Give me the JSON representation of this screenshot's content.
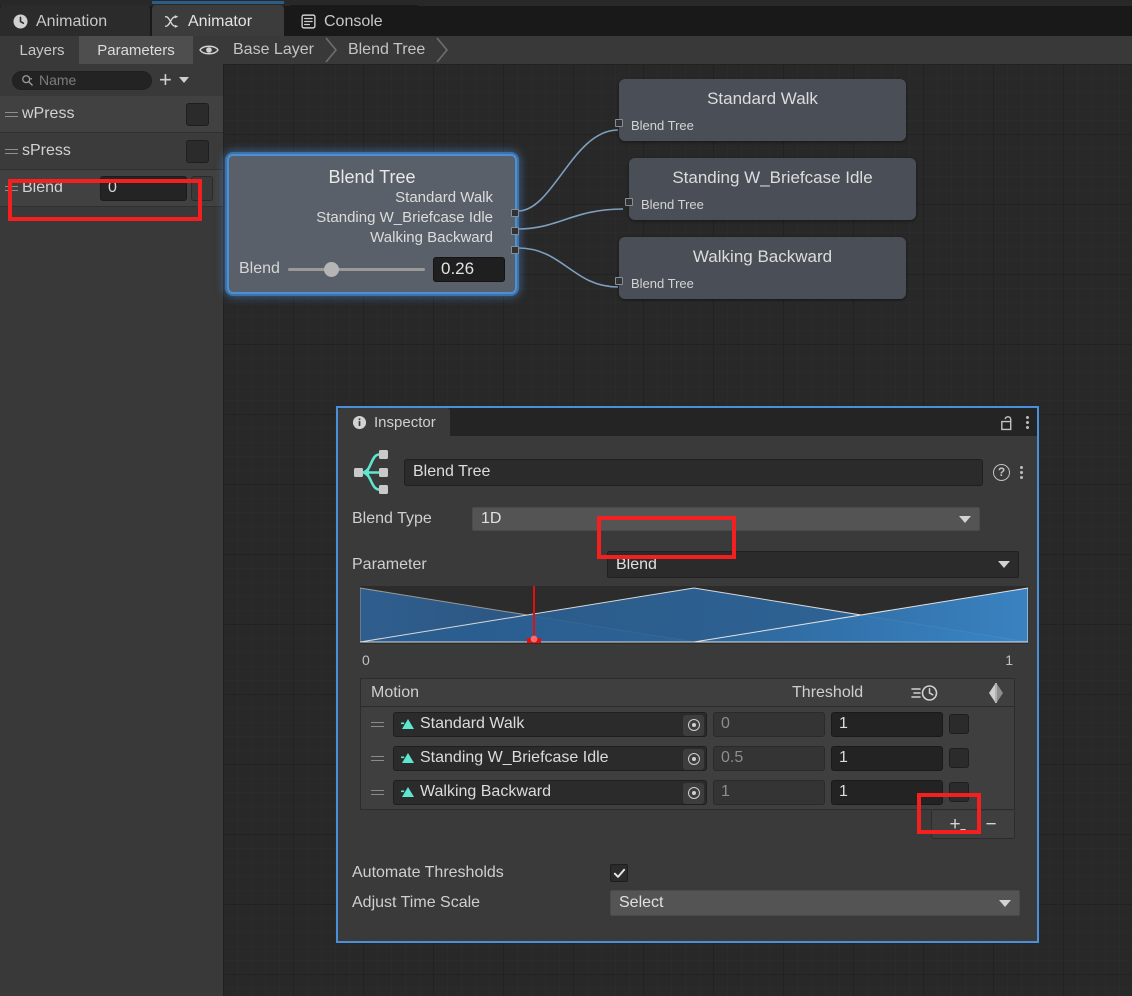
{
  "window": {
    "tabs": [
      {
        "label": "Animation",
        "icon": "clock-icon",
        "active": false
      },
      {
        "label": "Animator",
        "icon": "animator-icon",
        "active": true
      },
      {
        "label": "Console",
        "icon": "console-icon",
        "active": false
      }
    ]
  },
  "subbar": {
    "layers_label": "Layers",
    "parameters_label": "Parameters",
    "eye_icon": "eye-icon",
    "breadcrumbs": [
      "Base Layer",
      "Blend Tree"
    ]
  },
  "parameters_panel": {
    "search_placeholder": "Name",
    "add_label": "+",
    "rows": [
      {
        "name": "wPress",
        "type": "bool",
        "value": ""
      },
      {
        "name": "sPress",
        "type": "bool",
        "value": ""
      },
      {
        "name": "Blend",
        "type": "float",
        "value": "0",
        "highlighted": true
      }
    ]
  },
  "graph": {
    "root_node": {
      "title": "Blend Tree",
      "children": [
        "Standard Walk",
        "Standing W_Briefcase Idle",
        "Walking Backward"
      ],
      "blend_label": "Blend",
      "blend_value": "0.26",
      "slider_percent": 26,
      "selected": true
    },
    "child_nodes": [
      {
        "title": "Standard Walk",
        "subtitle": "Blend Tree"
      },
      {
        "title": "Standing W_Briefcase Idle",
        "subtitle": "Blend Tree"
      },
      {
        "title": "Walking Backward",
        "subtitle": "Blend Tree"
      }
    ]
  },
  "inspector": {
    "tab_label": "Inspector",
    "info_icon": "info-icon",
    "lock_icon": "lock-open-icon",
    "menu_icon": "kebab-menu-icon",
    "asset_icon": "blend-tree-icon",
    "name_value": "Blend Tree",
    "help_icon": "help-icon",
    "blend_type_label": "Blend Type",
    "blend_type_value": "1D",
    "parameter_label": "Parameter",
    "parameter_value": "Blend",
    "axis_min": "0",
    "axis_max": "1",
    "table": {
      "headers": [
        "Motion",
        "Threshold",
        "speed-icon",
        "mirror-icon"
      ],
      "rows": [
        {
          "motion": "Standard Walk",
          "threshold": "0",
          "speed": "1",
          "mirror": false
        },
        {
          "motion": "Standing W_Briefcase Idle",
          "threshold": "0.5",
          "speed": "1",
          "mirror": false
        },
        {
          "motion": "Walking Backward",
          "threshold": "1",
          "speed": "1",
          "mirror": false
        }
      ]
    },
    "add_button_label": "+",
    "remove_button_label": "−",
    "automate_thresholds_label": "Automate Thresholds",
    "automate_thresholds_checked": true,
    "adjust_time_scale_label": "Adjust Time Scale",
    "adjust_time_scale_value": "Select"
  },
  "annotations": {
    "highlight_color": "#f42020",
    "boxes": [
      "blend-parameter-row",
      "parameter-dropdown",
      "add-motion-button"
    ]
  },
  "chart_data": {
    "type": "area",
    "title": "Blend weight graph",
    "x": [
      0,
      0.5,
      1
    ],
    "series": [
      {
        "name": "Standard Walk",
        "values": [
          1,
          0,
          0
        ]
      },
      {
        "name": "Standing W_Briefcase Idle",
        "values": [
          0,
          1,
          0
        ]
      },
      {
        "name": "Walking Backward",
        "values": [
          0,
          0,
          1
        ]
      }
    ],
    "xlim": [
      0,
      1
    ],
    "ylim": [
      0,
      1
    ],
    "marker_x": 0.26,
    "xlabel": "",
    "ylabel": "",
    "grid": false,
    "legend": "none"
  }
}
